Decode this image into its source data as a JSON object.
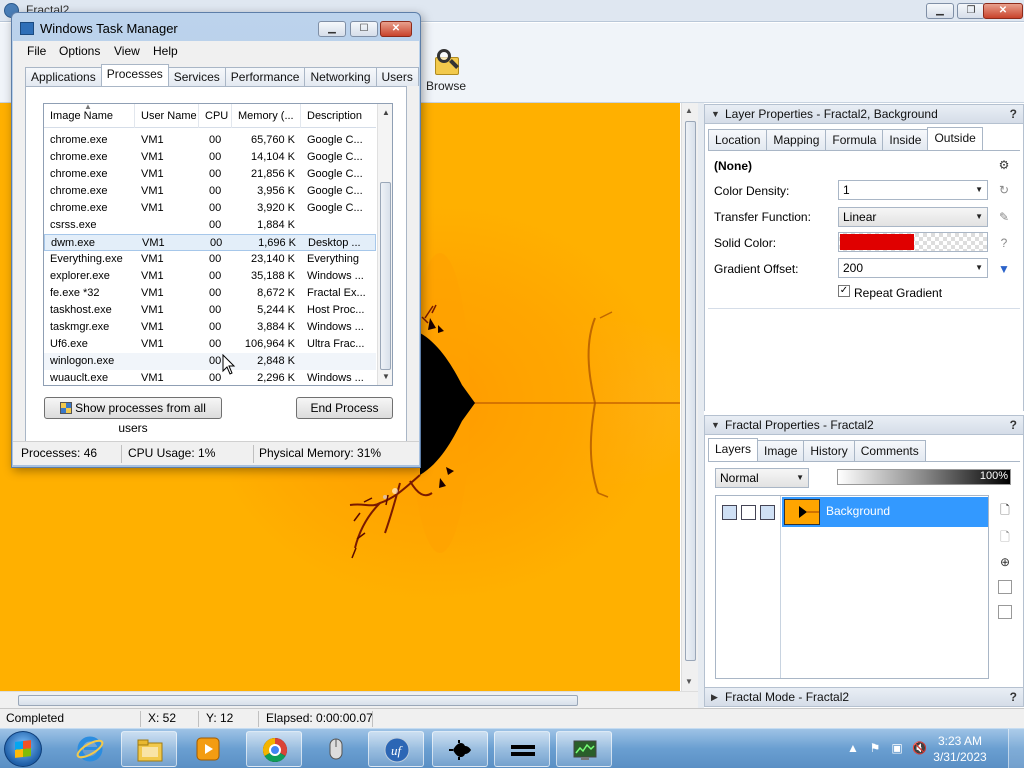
{
  "app": {
    "title": "Fractal2",
    "browse_label": "Browse"
  },
  "layer_properties": {
    "header": "Layer Properties - Fractal2, Background",
    "tabs": [
      "Location",
      "Mapping",
      "Formula",
      "Inside",
      "Outside"
    ],
    "active_tab": "Outside",
    "formula_name": "(None)",
    "color_density_label": "Color Density:",
    "color_density_value": "1",
    "transfer_function_label": "Transfer Function:",
    "transfer_function_value": "Linear",
    "solid_color_label": "Solid Color:",
    "solid_color": "#e00000",
    "gradient_offset_label": "Gradient Offset:",
    "gradient_offset_value": "200",
    "repeat_gradient_label": "Repeat Gradient",
    "repeat_gradient_checked": true
  },
  "fractal_properties": {
    "header": "Fractal Properties - Fractal2",
    "tabs": [
      "Layers",
      "Image",
      "History",
      "Comments"
    ],
    "active_tab": "Layers",
    "merge_mode": "Normal",
    "opacity": "100%",
    "layers": [
      {
        "name": "Background"
      }
    ]
  },
  "fractal_mode": {
    "header": "Fractal Mode - Fractal2"
  },
  "statusbar": {
    "status": "Completed",
    "x": "X: 52",
    "y": "Y: 12",
    "elapsed": "Elapsed: 0:00:00.07"
  },
  "taskmgr": {
    "title": "Windows Task Manager",
    "menu": [
      "File",
      "Options",
      "View",
      "Help"
    ],
    "tabs": [
      "Applications",
      "Processes",
      "Services",
      "Performance",
      "Networking",
      "Users"
    ],
    "active_tab": "Processes",
    "columns": [
      "Image Name",
      "User Name",
      "CPU",
      "Memory (...",
      "Description"
    ],
    "processes": [
      {
        "name": "chrome.exe",
        "user": "VM1",
        "cpu": "00",
        "mem": "65,760 K",
        "desc": "Google C..."
      },
      {
        "name": "chrome.exe",
        "user": "VM1",
        "cpu": "00",
        "mem": "14,104 K",
        "desc": "Google C..."
      },
      {
        "name": "chrome.exe",
        "user": "VM1",
        "cpu": "00",
        "mem": "21,856 K",
        "desc": "Google C..."
      },
      {
        "name": "chrome.exe",
        "user": "VM1",
        "cpu": "00",
        "mem": "3,956 K",
        "desc": "Google C..."
      },
      {
        "name": "chrome.exe",
        "user": "VM1",
        "cpu": "00",
        "mem": "3,920 K",
        "desc": "Google C..."
      },
      {
        "name": "csrss.exe",
        "user": "",
        "cpu": "00",
        "mem": "1,884 K",
        "desc": ""
      },
      {
        "name": "dwm.exe",
        "user": "VM1",
        "cpu": "00",
        "mem": "1,696 K",
        "desc": "Desktop ..."
      },
      {
        "name": "Everything.exe",
        "user": "VM1",
        "cpu": "00",
        "mem": "23,140 K",
        "desc": "Everything"
      },
      {
        "name": "explorer.exe",
        "user": "VM1",
        "cpu": "00",
        "mem": "35,188 K",
        "desc": "Windows ..."
      },
      {
        "name": "fe.exe *32",
        "user": "VM1",
        "cpu": "00",
        "mem": "8,672 K",
        "desc": "Fractal Ex..."
      },
      {
        "name": "taskhost.exe",
        "user": "VM1",
        "cpu": "00",
        "mem": "5,244 K",
        "desc": "Host Proc..."
      },
      {
        "name": "taskmgr.exe",
        "user": "VM1",
        "cpu": "00",
        "mem": "3,884 K",
        "desc": "Windows ..."
      },
      {
        "name": "Uf6.exe",
        "user": "VM1",
        "cpu": "00",
        "mem": "106,964 K",
        "desc": "Ultra Frac..."
      },
      {
        "name": "winlogon.exe",
        "user": "",
        "cpu": "00",
        "mem": "2,848 K",
        "desc": ""
      },
      {
        "name": "wuauclt.exe",
        "user": "VM1",
        "cpu": "00",
        "mem": "2,296 K",
        "desc": "Windows ..."
      }
    ],
    "selected_process": "dwm.exe",
    "show_all_label": "Show processes from all users",
    "end_process_label": "End Process",
    "status_processes": "Processes: 46",
    "status_cpu": "CPU Usage: 1%",
    "status_memory": "Physical Memory: 31%"
  },
  "taskbar": {
    "apps": [
      "internet-explorer",
      "file-explorer",
      "media-player",
      "chrome",
      "mouse",
      "ultra-fractal",
      "fractal-extreme",
      "equals",
      "task-manager"
    ],
    "time": "3:23 AM",
    "date": "3/31/2023"
  }
}
